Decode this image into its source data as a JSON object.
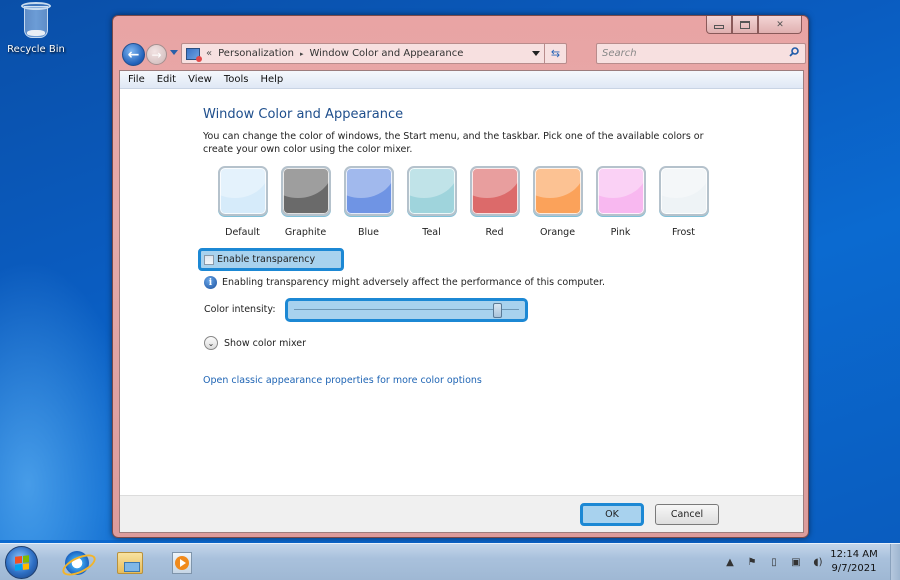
{
  "desktop": {
    "icons": [
      {
        "label": "Recycle Bin",
        "icon": "recycle-bin-icon"
      }
    ]
  },
  "window": {
    "caption_buttons": [
      "minimize",
      "maximize",
      "close"
    ],
    "address_bar": {
      "prefix": "«",
      "breadcrumbs": [
        "Personalization",
        "Window Color and Appearance"
      ],
      "separator": "▸"
    },
    "search": {
      "placeholder": "Search"
    },
    "menu": [
      "File",
      "Edit",
      "View",
      "Tools",
      "Help"
    ]
  },
  "page": {
    "title": "Window Color and Appearance",
    "description": "You can change the color of windows, the Start menu, and the taskbar. Pick one of the available colors or create your own color using the color mixer.",
    "swatches": [
      {
        "label": "Default",
        "color": "#d6ebfa"
      },
      {
        "label": "Graphite",
        "color": "#6a6a6a"
      },
      {
        "label": "Blue",
        "color": "#6f94e4"
      },
      {
        "label": "Teal",
        "color": "#9fd4dc"
      },
      {
        "label": "Red",
        "color": "#dc6a6a"
      },
      {
        "label": "Orange",
        "color": "#fba25a"
      },
      {
        "label": "Pink",
        "color": "#f8b8f0"
      },
      {
        "label": "Frost",
        "color": "#eef3f6"
      }
    ],
    "transparency": {
      "label": "Enable transparency",
      "checked": false
    },
    "info_text": "Enabling transparency might adversely affect the performance of this computer.",
    "intensity": {
      "label": "Color intensity:",
      "value_percent": 90
    },
    "mixer_label": "Show color mixer",
    "classic_link": "Open classic appearance properties for more color options",
    "buttons": {
      "ok": "OK",
      "cancel": "Cancel"
    }
  },
  "taskbar": {
    "pinned": [
      "start-button",
      "internet-explorer",
      "windows-explorer",
      "media-player"
    ],
    "tray": {
      "time": "12:14 AM",
      "date": "9/7/2021"
    }
  },
  "colors": {
    "focus_blue": "#1c88d4",
    "focus_fill": "#a8d2ee",
    "title_blue": "#1e4e8c",
    "link_blue": "#1e64b4",
    "window_frame": "#e3aaaa"
  }
}
